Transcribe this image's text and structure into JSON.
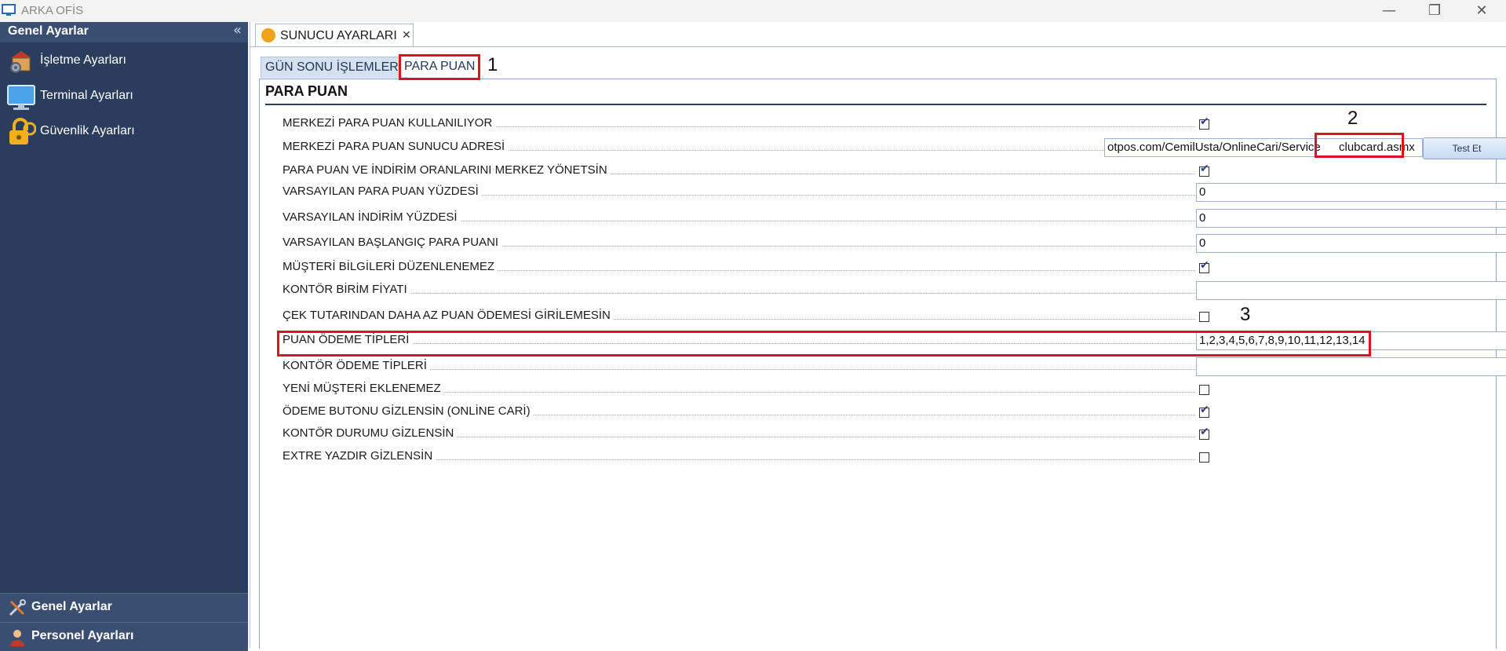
{
  "window": {
    "title": "ARKA OFİS"
  },
  "sidebar": {
    "header": "Genel Ayarlar",
    "items": [
      {
        "label": "İşletme Ayarları"
      },
      {
        "label": "Terminal Ayarları"
      },
      {
        "label": "Güvenlik Ayarları"
      }
    ],
    "bottom": [
      {
        "label": "Genel Ayarlar"
      },
      {
        "label": "Personel Ayarları"
      }
    ]
  },
  "doc_tab": {
    "label": "SUNUCU AYARLARI"
  },
  "tabs": [
    {
      "label": "GÜN SONU İŞLEMLERİ"
    },
    {
      "label": "PARA PUAN"
    }
  ],
  "section": {
    "title": "PARA PUAN"
  },
  "annotations": [
    "1",
    "2",
    "3"
  ],
  "settings": [
    {
      "label": "MERKEZİ PARA PUAN KULLANILIYOR",
      "type": "checkbox",
      "checked": true
    },
    {
      "label": "MERKEZİ PARA PUAN SUNUCU ADRESİ",
      "type": "url",
      "value": "otpos.com/CemilUsta/OnlineCari/Service",
      "value_tail": "clubcard.asmx",
      "button": "Test Et"
    },
    {
      "label": "PARA PUAN VE İNDİRİM ORANLARINI MERKEZ YÖNETSİN",
      "type": "checkbox",
      "checked": true
    },
    {
      "label": "VARSAYILAN PARA PUAN YÜZDESİ",
      "type": "text",
      "value": "0"
    },
    {
      "label": "VARSAYILAN İNDİRİM YÜZDESİ",
      "type": "text",
      "value": "0"
    },
    {
      "label": "VARSAYILAN BAŞLANGIÇ PARA PUANI",
      "type": "text",
      "value": "0"
    },
    {
      "label": "MÜŞTERİ BİLGİLERİ DÜZENLENEMEZ",
      "type": "checkbox",
      "checked": true
    },
    {
      "label": "KONTÖR BİRİM FİYATI",
      "type": "text",
      "value": ""
    },
    {
      "label": "ÇEK TUTARINDAN DAHA AZ PUAN ÖDEMESİ GİRİLEMESİN",
      "type": "checkbox",
      "checked": false
    },
    {
      "label": "PUAN ÖDEME TİPLERİ",
      "type": "text",
      "value": "1,2,3,4,5,6,7,8,9,10,11,12,13,14"
    },
    {
      "label": "KONTÖR ÖDEME TİPLERİ",
      "type": "text",
      "value": ""
    },
    {
      "label": "YENİ MÜŞTERİ EKLENEMEZ",
      "type": "checkbox",
      "checked": false
    },
    {
      "label": "ÖDEME BUTONU GİZLENSİN (ONLİNE CARİ)",
      "type": "checkbox",
      "checked": true
    },
    {
      "label": "KONTÖR DURUMU GİZLENSİN",
      "type": "checkbox",
      "checked": true
    },
    {
      "label": "EXTRE YAZDIR GİZLENSİN",
      "type": "checkbox",
      "checked": false
    }
  ]
}
